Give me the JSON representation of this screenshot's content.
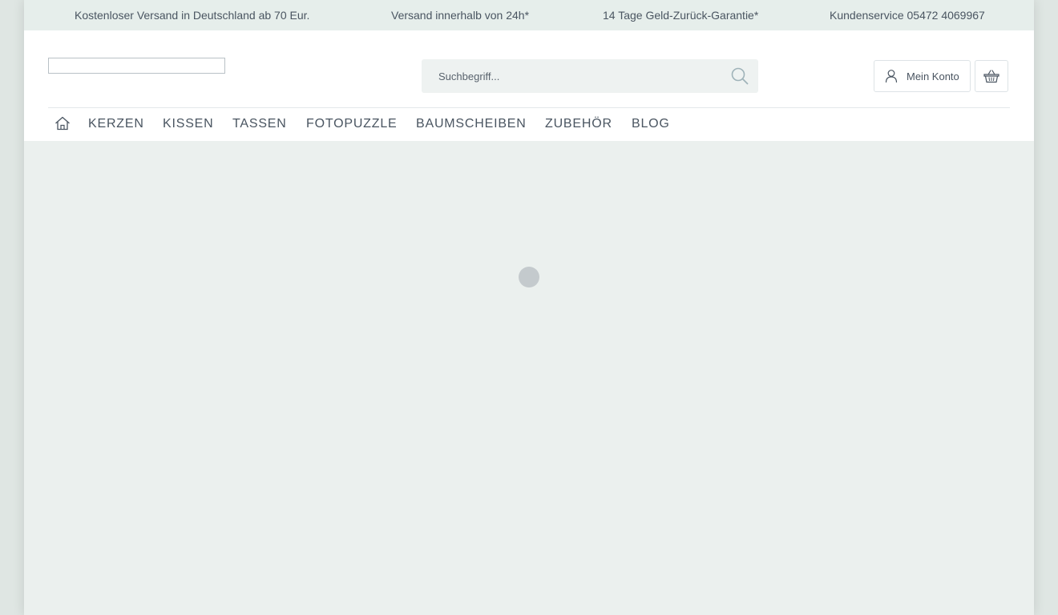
{
  "topbar": {
    "shipping": "Kostenloser Versand in Deutschland ab 70 Eur.",
    "delivery": "Versand innerhalb von 24h*",
    "guarantee": "14 Tage Geld-Zurück-Garantie*",
    "service": "Kundenservice 05472 4069967"
  },
  "search": {
    "placeholder": "Suchbegriff..."
  },
  "account": {
    "label": "Mein Konto"
  },
  "nav": {
    "items": [
      {
        "label": "KERZEN"
      },
      {
        "label": "KISSEN"
      },
      {
        "label": "TASSEN"
      },
      {
        "label": "FOTOPUZZLE"
      },
      {
        "label": "BAUMSCHEIBEN"
      },
      {
        "label": "ZUBEHÖR"
      },
      {
        "label": "BLOG"
      }
    ]
  },
  "icons": {
    "home": "home-icon",
    "search": "search-icon",
    "user": "user-icon",
    "cart": "basket-icon"
  },
  "colors": {
    "text": "#4a5561",
    "background": "#ebf0ee",
    "header": "#ffffff",
    "search_icon": "#9fb3b9"
  }
}
